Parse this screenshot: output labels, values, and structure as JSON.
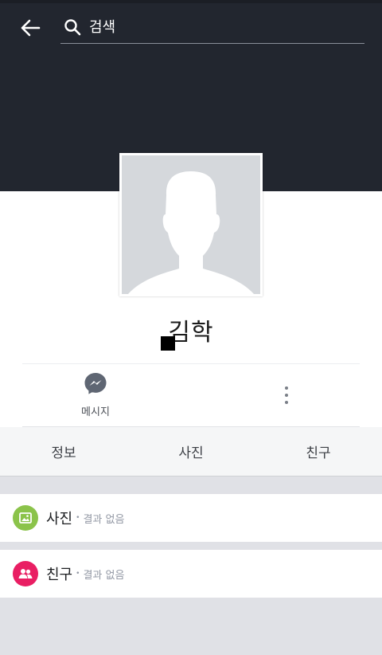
{
  "header": {
    "search_placeholder": "검색"
  },
  "profile": {
    "name": "김학"
  },
  "actions": {
    "message_label": "메시지"
  },
  "tabs": [
    {
      "label": "정보"
    },
    {
      "label": "사진"
    },
    {
      "label": "친구"
    }
  ],
  "sections": {
    "photos": {
      "title": "사진",
      "separator": "•",
      "status": "결과 없음",
      "icon": "image-icon",
      "color": "#8bc34a"
    },
    "friends": {
      "title": "친구",
      "separator": "•",
      "status": "결과 없음",
      "icon": "friends-icon",
      "color": "#e91e63"
    }
  },
  "colors": {
    "cover": "#22262f",
    "background": "#e0e1e6",
    "tab_bar": "#f5f6f7"
  }
}
